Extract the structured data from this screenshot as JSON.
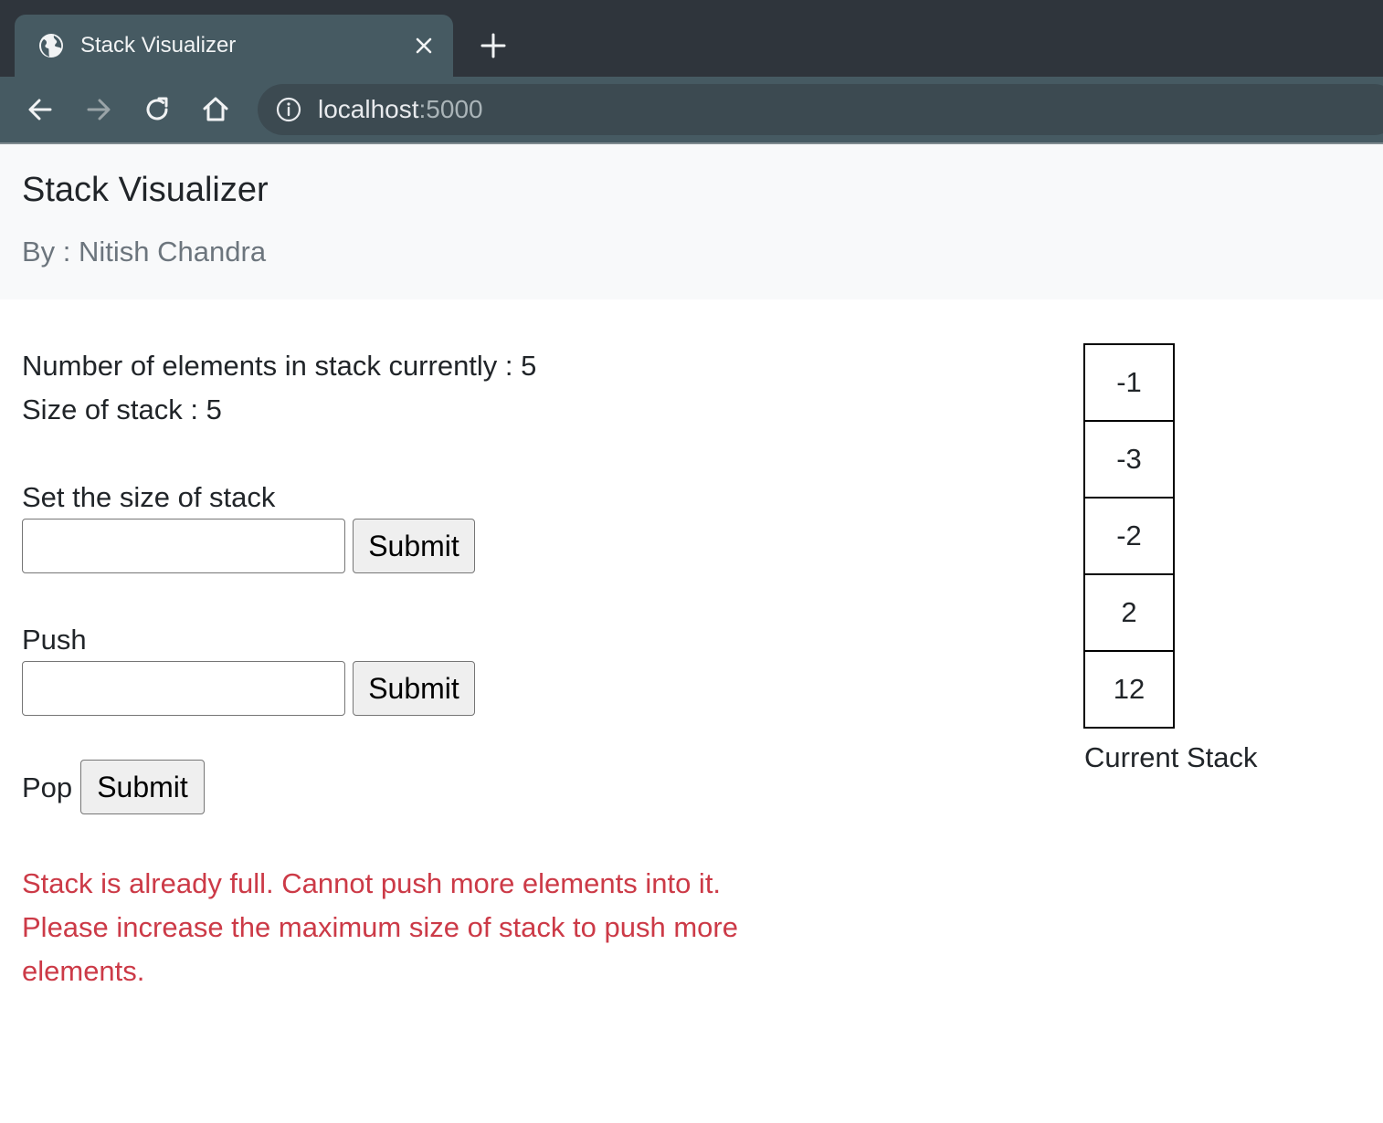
{
  "browser": {
    "tab_title": "Stack Visualizer",
    "url_host": "localhost",
    "url_port": ":5000",
    "icons": {
      "tab": "globe-icon",
      "close": "close-icon",
      "new_tab": "plus-icon",
      "back": "back-arrow-icon",
      "forward": "forward-arrow-icon",
      "reload": "reload-icon",
      "home": "home-icon",
      "site_info": "info-icon"
    }
  },
  "header": {
    "title": "Stack Visualizer",
    "subtitle": "By : Nitish Chandra"
  },
  "stats": {
    "element_count": "Number of elements in stack currently : 5",
    "stack_size": "Size of stack : 5"
  },
  "forms": {
    "set_size": {
      "label": "Set the size of stack",
      "value": "",
      "button": "Submit"
    },
    "push": {
      "label": "Push",
      "value": "",
      "button": "Submit"
    },
    "pop": {
      "label": "Pop",
      "button": "Submit"
    }
  },
  "error": {
    "line1": "Stack is already full. Cannot push more elements into it.",
    "line2": "Please increase the maximum size of stack to push more elements."
  },
  "stack": {
    "items": [
      "-1",
      "-3",
      "-2",
      "2",
      "12"
    ],
    "label": "Current Stack"
  },
  "colors": {
    "error": "#cc3a47",
    "header_bg": "#f8f9fa",
    "subtitle": "#6c757d"
  }
}
